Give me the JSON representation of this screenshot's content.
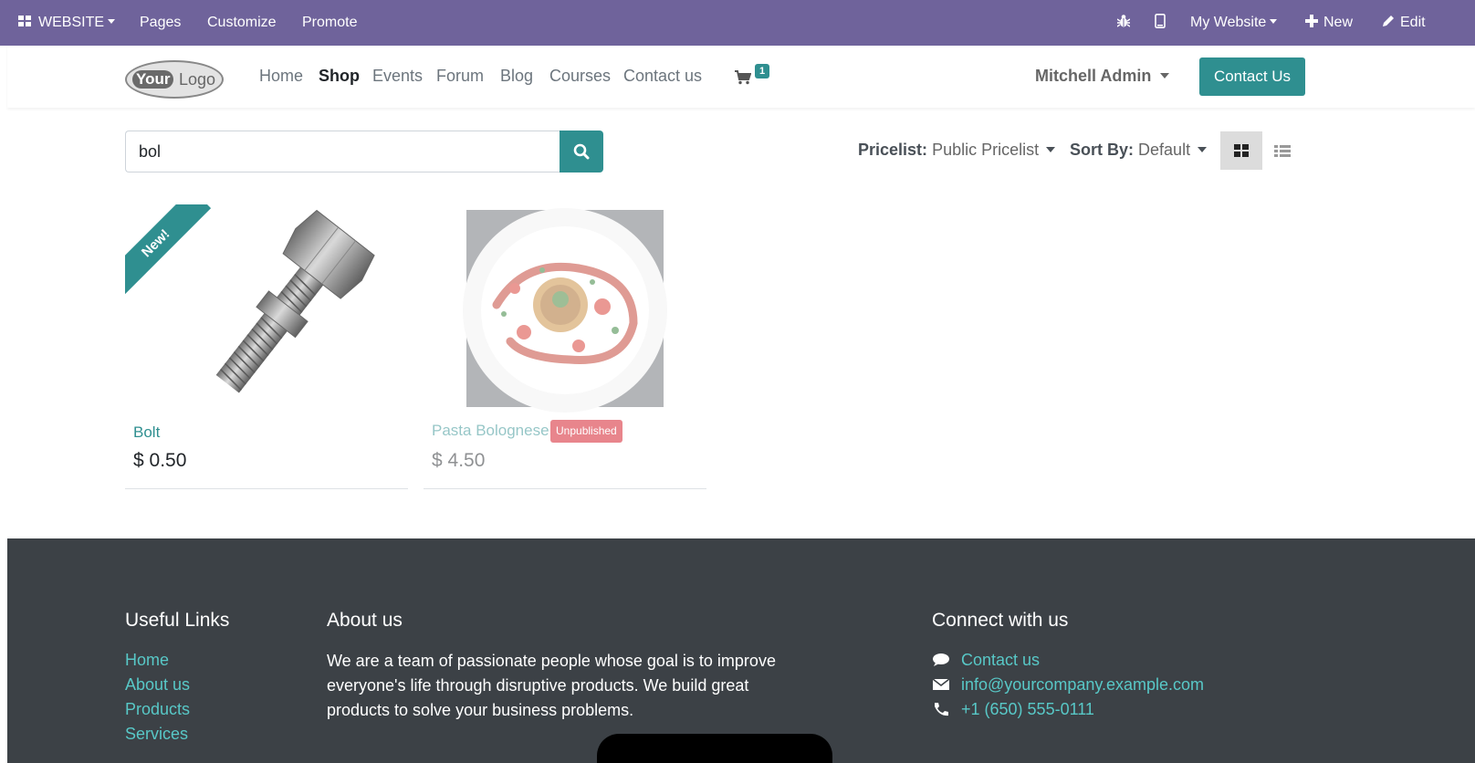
{
  "admin_bar": {
    "website_label": "WEBSITE",
    "menu": [
      "Pages",
      "Customize",
      "Promote"
    ],
    "my_website": "My Website",
    "new_label": "New",
    "edit_label": "Edit"
  },
  "header": {
    "logo_your": "Your",
    "logo_logo": "Logo",
    "nav": [
      "Home",
      "Shop",
      "Events",
      "Forum",
      "Blog",
      "Courses",
      "Contact us"
    ],
    "active_nav": "Shop",
    "cart_count": "1",
    "user_name": "Mitchell Admin",
    "contact_button": "Contact Us"
  },
  "search": {
    "value": "bol"
  },
  "options": {
    "pricelist_label": "Pricelist:",
    "pricelist_value": "Public Pricelist",
    "sort_label": "Sort By:",
    "sort_value": "Default"
  },
  "products": [
    {
      "name": "Bolt",
      "price": "$ 0.50",
      "ribbon": "New!",
      "published": true
    },
    {
      "name": "Pasta Bolognese",
      "price": "$ 4.50",
      "badge": "Unpublished",
      "published": false
    }
  ],
  "footer": {
    "useful_links_title": "Useful Links",
    "useful_links": [
      "Home",
      "About us",
      "Products",
      "Services"
    ],
    "about_title": "About us",
    "about_text": "We are a team of passionate people whose goal is to improve everyone's life through disruptive products. We build great products to solve your business problems.",
    "connect_title": "Connect with us",
    "contact_link": "Contact us",
    "email": "info@yourcompany.example.com",
    "phone": "+1 (650) 555-0111"
  },
  "colors": {
    "admin_bar": "#6f639b",
    "primary": "#2f8f90",
    "footer_bg": "#3c4146",
    "footer_link": "#58c8c7",
    "unpublished_badge": "#e8858c"
  }
}
